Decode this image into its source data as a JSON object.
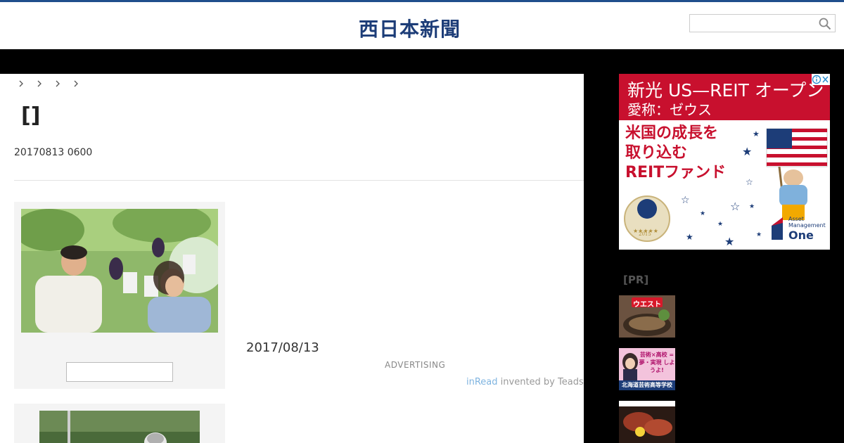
{
  "header": {
    "logo_text": "西日本新聞",
    "search_placeholder": ""
  },
  "article": {
    "title": "[]",
    "datetime": "20170813 0600",
    "pub_date": "2017/08/13",
    "ad_label": "ADVERTISING",
    "inread_link": "inRead",
    "inread_suffix": " invented by Teads"
  },
  "sidebar_ad": {
    "line1": "新光 US—REIT オープン",
    "line2": "愛称：ゼウス",
    "copy_1": "米国の成長を",
    "copy_2": "取り込む",
    "copy_3": "REITファンド",
    "brand_small": "Asset Management",
    "brand_large": "One",
    "award_year": "2015"
  },
  "pr": {
    "label": "[PR]",
    "thumbs": [
      {
        "label": "ウエスト"
      },
      {
        "label": "芸術×高校 =夢・実現 しようよ!",
        "sub": "北海道芸術高等学校"
      },
      {
        "label": ""
      }
    ]
  },
  "colors": {
    "brand_blue": "#1d3d78",
    "ad_red": "#c8102e",
    "black_band": "#000000"
  },
  "icons": [
    "search-icon",
    "chevron-right-icon",
    "adchoices-icon"
  ]
}
